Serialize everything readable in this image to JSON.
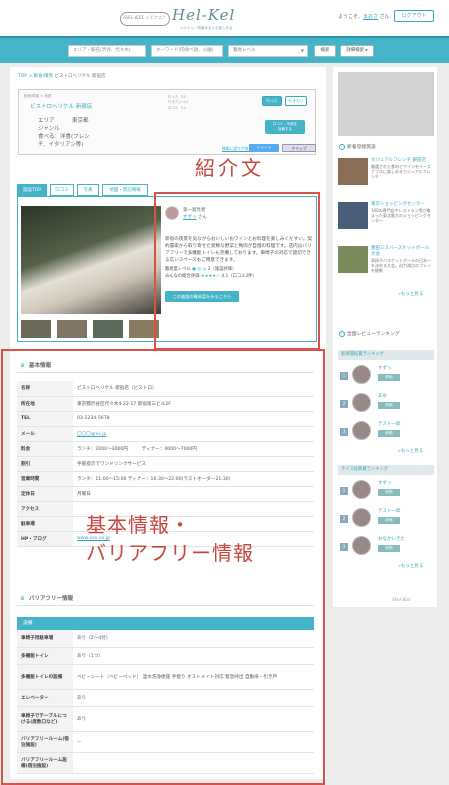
{
  "header": {
    "bubble": "HEL-KELってナニ？",
    "logo": "Hel-Kel",
    "logo_sub": "ヘルケル／障害ある人も楽しめる",
    "welcome_prefix": "ようこそ、",
    "user": "まおさ",
    "welcome_suffix": " さん",
    "logout_label": "ログアウト"
  },
  "search": {
    "area_placeholder": "エリア・駅名(渋谷、代々木)",
    "keyword_placeholder": "キーワード(肉食べ放、公園)",
    "level_placeholder": "難易レベル",
    "search_label": "検索",
    "advanced_label": "詳細検索 ▸"
  },
  "breadcrumb": {
    "top": "TOP",
    "sep": " > ",
    "cat": "飲食/障害",
    "current": " ビストロヘリケル 新宿店"
  },
  "shop": {
    "label": "飲食/障害 > 地図",
    "name": "ビストロヘリケル 新宿店",
    "meta": "行った  5人\n行きたい 5人\n口コミ  5人",
    "went_btn": "行った",
    "want_btn": "行きたい",
    "area_key": "エリア",
    "area_val": "東京都",
    "genre_key": "ジャンル",
    "genre_val": "食べる：洋食(フレン",
    "genre_val2": "チ、イタリアン等)",
    "add_review_btn": "口コミ・写真を\n投稿する",
    "report_link": "情報に誤りがある場合",
    "tweet_btn": "ツイート",
    "clip_btn": "クリップ"
  },
  "tabs": [
    "施設TOP",
    "口コミ",
    "写真",
    "地図・周辺情報"
  ],
  "intro": {
    "reviewer_title": "第一発見者",
    "reviewer_name": "すずっ",
    "reviewer_suffix": " さん",
    "text": "新宿の夜景を気ながらおいしいおワインとお料理を楽しみくだすい。契約農家から取り寄せた新鮮な野菜と鴨肉が自慢の料理です。店内はバリアフリーで多機能トイレも完備しております。車椅子の対応で貸切できる広いスペースもご用意できます。",
    "level_label": "難易度レベル",
    "level_value": "2（施設評価）",
    "rating_label": "みんなの総合評価",
    "stars": "★★★★☆",
    "rating_value": "4.1（口コミ3件）",
    "detail_btn": "この施設の難易度をみるこちら"
  },
  "annotations": {
    "intro": "紹介文",
    "info_line1": "基本情報・",
    "info_line2": "バリアフリー情報"
  },
  "basic_info": {
    "title": "基本情報",
    "rows": [
      {
        "k": "名称",
        "v": "ビストロヘリケル 新宿店（ビストロ）"
      },
      {
        "k": "所在地",
        "v": "東京都渋谷区代々木4-22-17 新宿第三ビル2F"
      },
      {
        "k": "TEL",
        "v": "03-1234-5678"
      },
      {
        "k": "メール",
        "v": "〇〇〇@xx.jp"
      },
      {
        "k": "料金",
        "v": "ランチ：2000〜3000円　　　ディナー：4000〜7000円"
      },
      {
        "k": "割引",
        "v": "手帳提示でワンドリンクサービス"
      },
      {
        "k": "営業時間",
        "v": "ランチ：11:00〜15:00 ディナー：16:30〜22:00(ラストオーダー21:30)"
      },
      {
        "k": "定休日",
        "v": "月曜日"
      },
      {
        "k": "アクセス",
        "v": ""
      },
      {
        "k": "駐車場",
        "v": ""
      },
      {
        "k": "HP・ブログ",
        "v": "www.xxx.co.jp"
      }
    ]
  },
  "barrier_free": {
    "title": "バリアフリー情報",
    "header": "設備",
    "rows": [
      {
        "k": "車椅子用駐車場",
        "v": "あり（2〜4付）"
      },
      {
        "k": "多機能トイレ",
        "v": "あり（1つ）"
      },
      {
        "k": "多機能トイレの設備",
        "v": "ベビーシート（ベビーベッド） 温水洗浄便座 手摺り オストメイト対応 緊急呼出 自動扉・引き戸"
      },
      {
        "k": "エレベーター",
        "v": "あり"
      },
      {
        "k": "車椅子でテーブルにつける(席数口など)",
        "v": "あり"
      },
      {
        "k": "バリアフリールーム(宿泊施設)",
        "v": "－"
      },
      {
        "k": "バリアフリールーム設備(宿泊施設)",
        "v": ""
      }
    ]
  },
  "sidebar": {
    "new_title": "新着登録施設",
    "new_items": [
      {
        "title": "カジュアルフレンチ 銀座店",
        "desc": "厳選された食材とワインをリーズナブルに楽しめるカジュアルフレンチ"
      },
      {
        "title": "東京ショッピングセンター",
        "desc": "100の専門店やレストラン等が集まった東北最大のショッピングセンター"
      },
      {
        "title": "墨田ミスバースケットボール大会",
        "desc": "車椅子バスケットボールの日本一を決める大会。迫力満点のプレーを観戦"
      }
    ],
    "more_label": "»もっと見る",
    "ranking_title": "全国レビューランキング",
    "rank_group1": "新規開拓賞ランキング",
    "rank_group1_items": [
      {
        "no": "1",
        "name": "すずっ",
        "tag": "評価"
      },
      {
        "no": "2",
        "name": "あゆ",
        "tag": "評価"
      },
      {
        "no": "3",
        "name": "テスト一郎",
        "tag": "評価"
      }
    ],
    "rank_group2": "ナイス投稿賞ランキング",
    "rank_group2_items": [
      {
        "no": "1",
        "name": "すずっ",
        "tag": "評価"
      },
      {
        "no": "2",
        "name": "テスト一郎",
        "tag": "評価"
      },
      {
        "no": "3",
        "name": "おなかいきた",
        "tag": "評価"
      }
    ],
    "footer_logo": "Hel-Kel"
  },
  "colors": {
    "accent": "#45b3c8",
    "annotation": "#d5534a",
    "background": "#ececec"
  }
}
